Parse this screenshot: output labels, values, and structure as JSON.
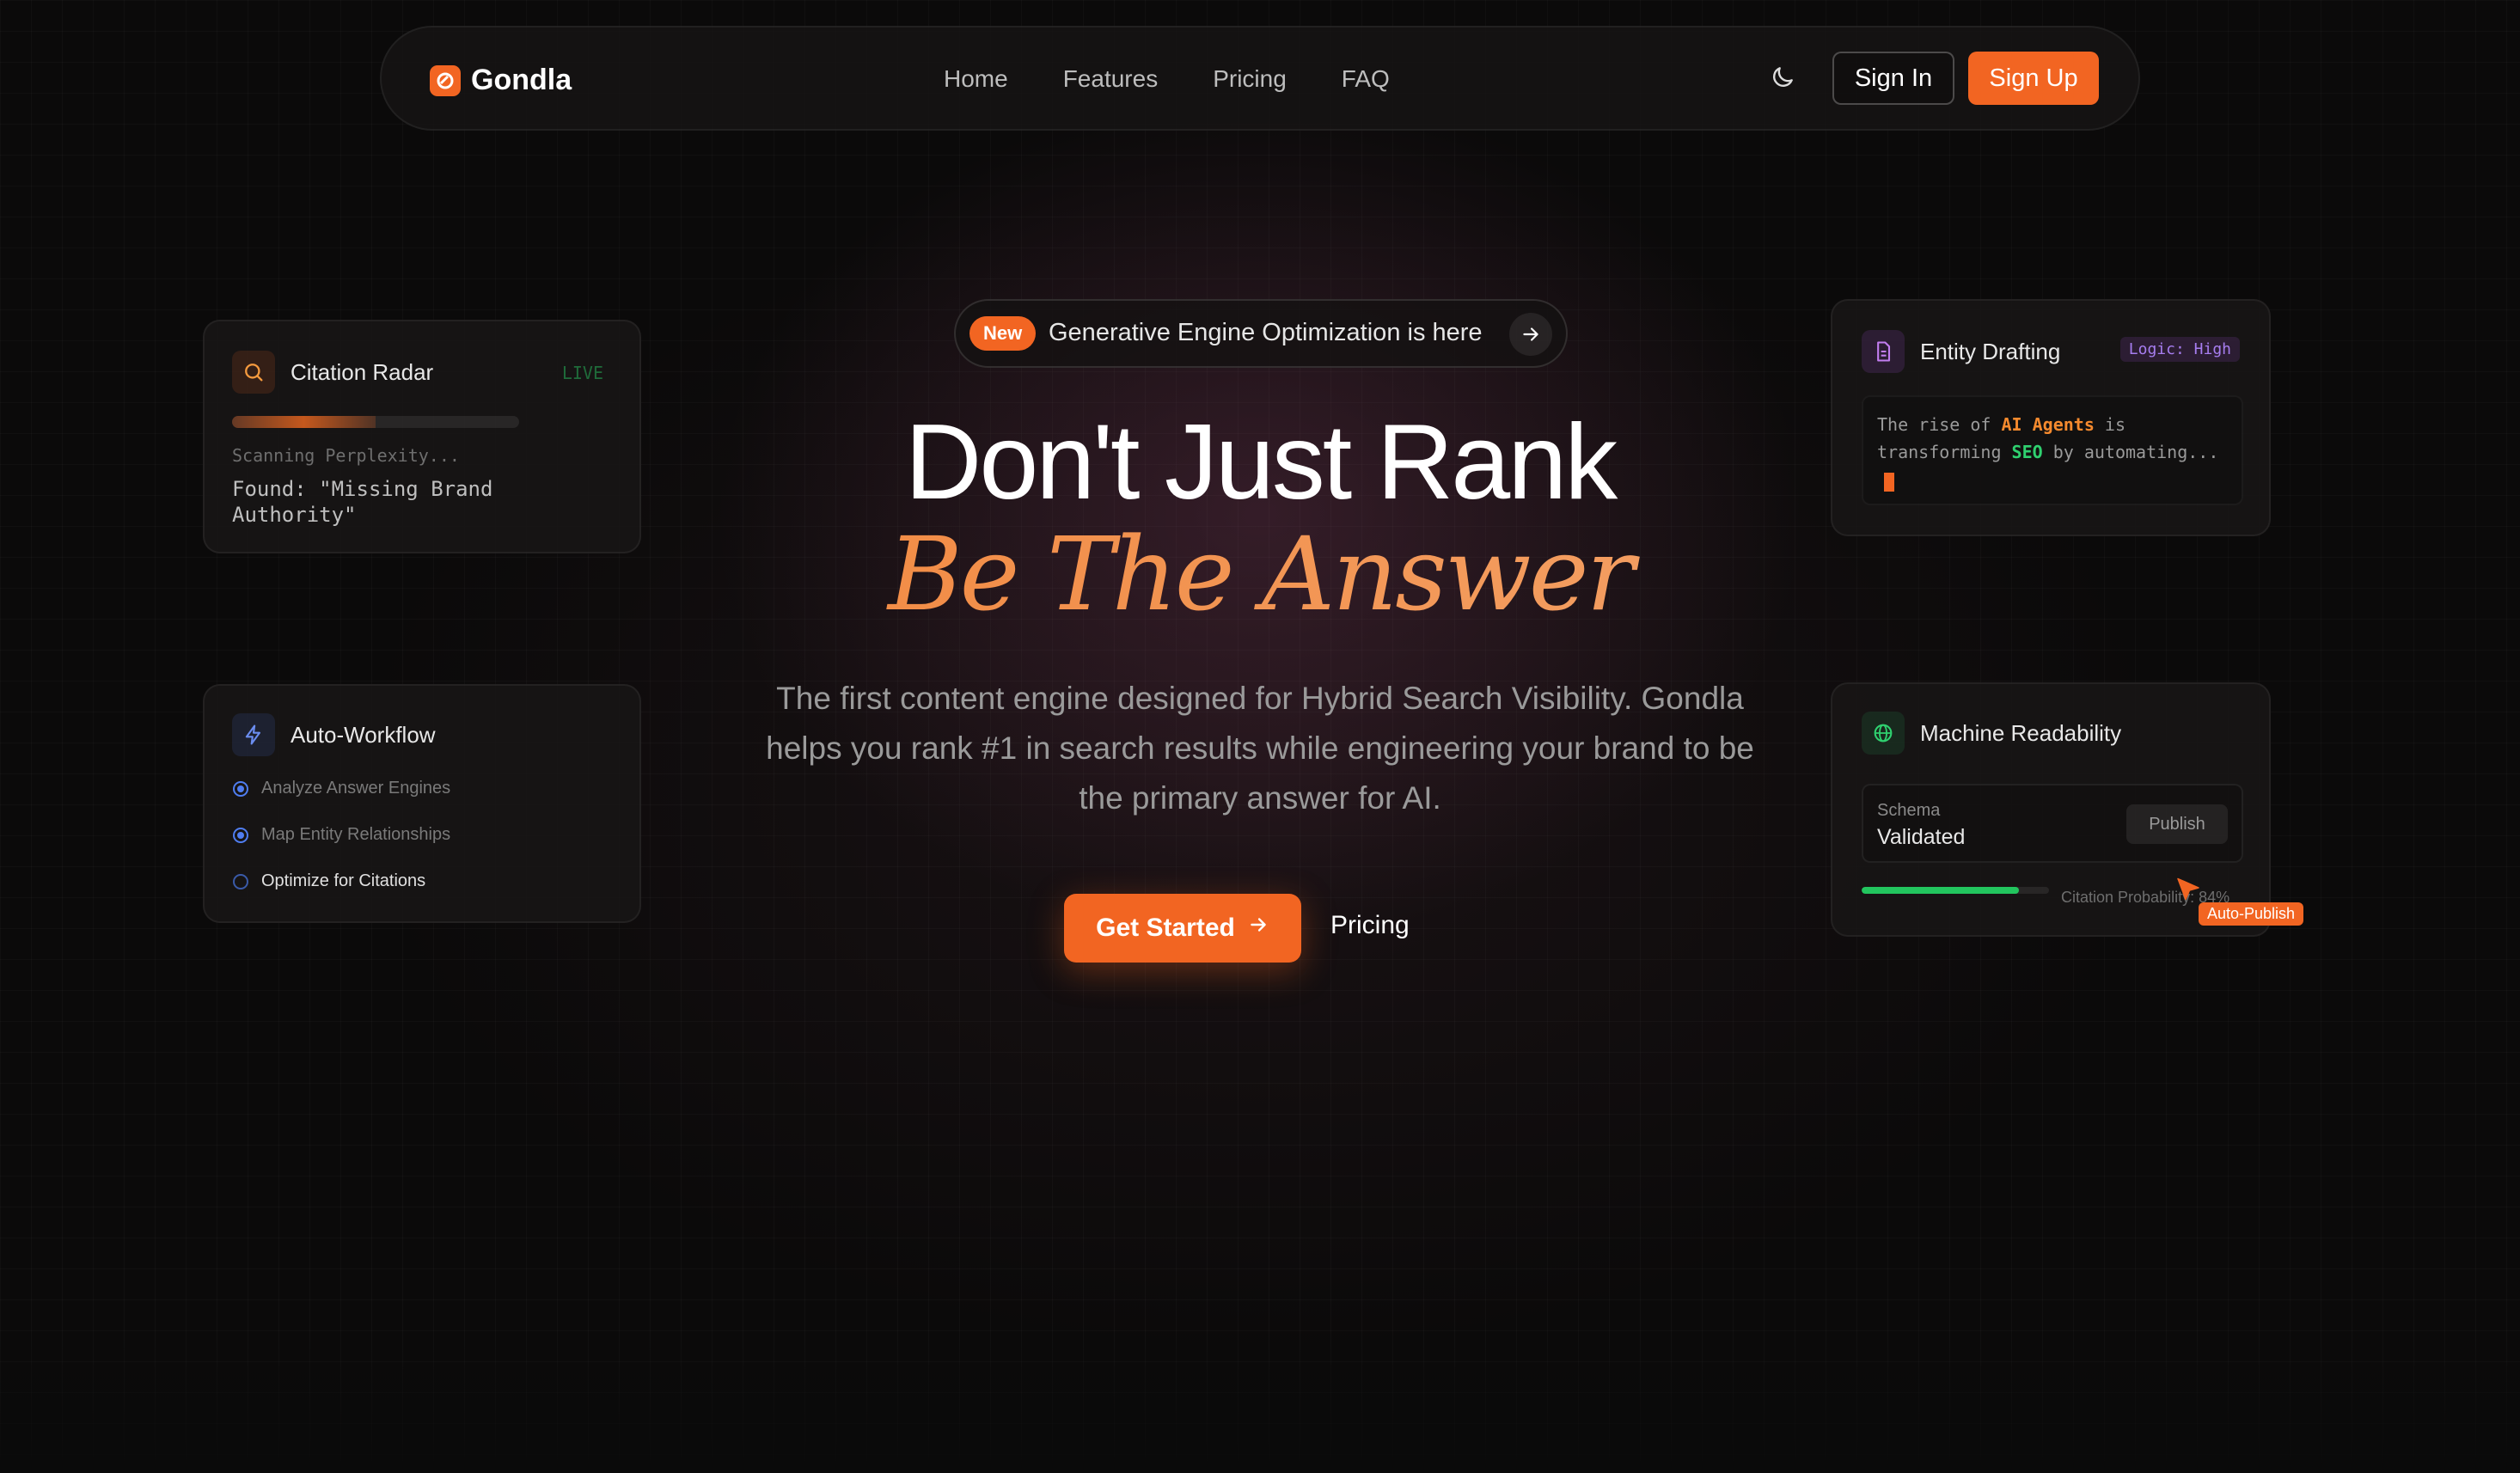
{
  "brand": {
    "name": "Gondla",
    "accent": "#f26522"
  },
  "nav": {
    "links": [
      "Home",
      "Features",
      "Pricing",
      "FAQ"
    ],
    "sign_in": "Sign In",
    "sign_up": "Sign Up",
    "theme_icon": "moon-icon"
  },
  "hero": {
    "badge": "New",
    "announcement": "Generative Engine Optimization is here",
    "headline": "Don't Just Rank",
    "headline_accent": "Be The Answer",
    "subtitle": "The first content engine designed for Hybrid Search Visibility. Gondla helps you rank #1 in search results while engineering your brand to be the primary answer for AI.",
    "cta_primary": "Get Started",
    "cta_secondary": "Pricing"
  },
  "cards": {
    "citation_radar": {
      "title": "Citation Radar",
      "status": "LIVE",
      "progress": 0.5,
      "scanning": "Scanning Perplexity...",
      "found": "Found: \"Missing Brand Authority\""
    },
    "auto_workflow": {
      "title": "Auto-Workflow",
      "steps": [
        "Analyze Answer Engines",
        "Map Entity Relationships",
        "Optimize for Citations"
      ]
    },
    "entity_drafting": {
      "title": "Entity Drafting",
      "tag": "Logic: High",
      "text_1": "The rise of ",
      "highlight_1": "AI Agents",
      "text_2": " is transforming ",
      "highlight_2": "SEO",
      "text_3": " by automating..."
    },
    "machine_readability": {
      "title": "Machine Readability",
      "schema_label": "Schema",
      "schema_value": "Validated",
      "publish": "Publish",
      "probability_label": "Citation Probability: 84%",
      "probability": 0.84,
      "auto_publish": "Auto-Publish"
    }
  }
}
